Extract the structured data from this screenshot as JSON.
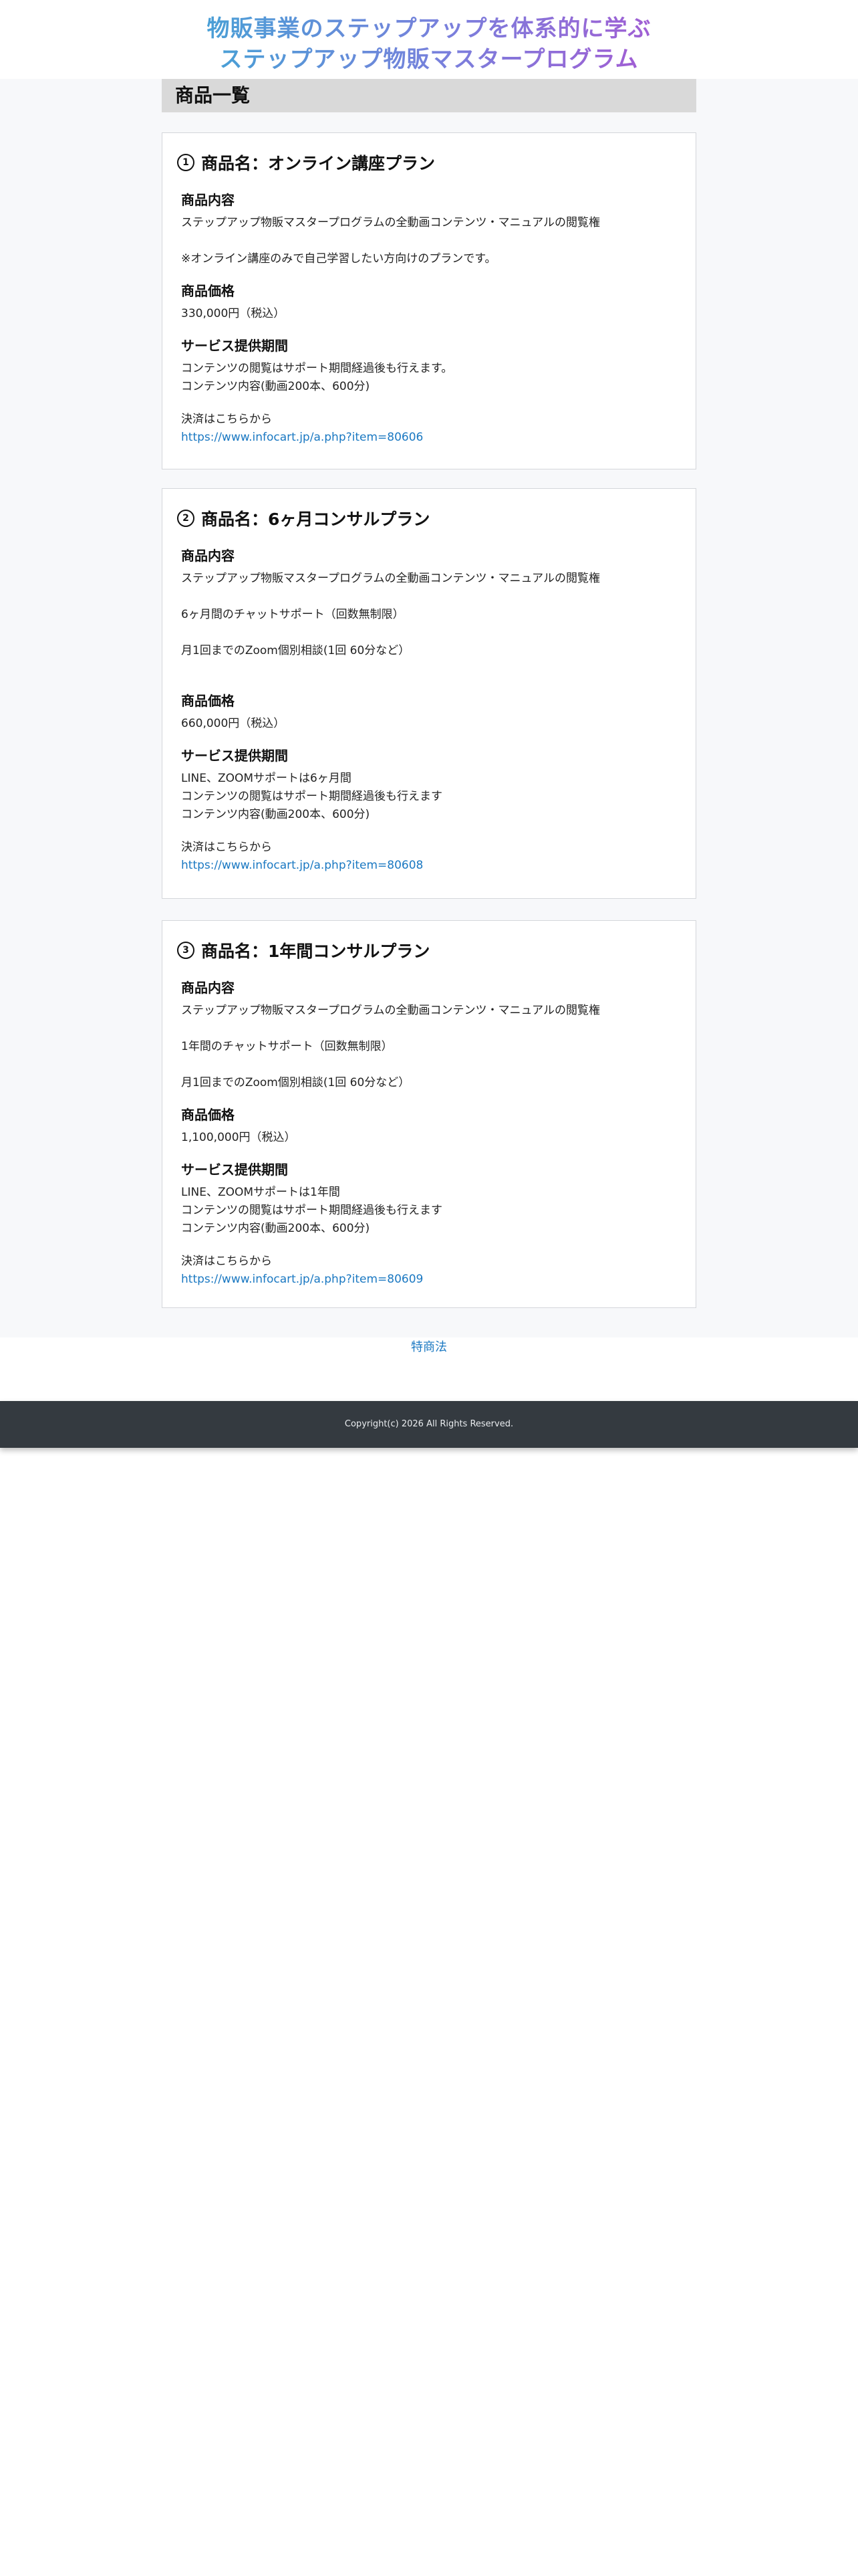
{
  "header": {
    "line1": "物販事業のステップアップを体系的に学ぶ",
    "line2": "ステップアップ物販マスタープログラム"
  },
  "section_title": "商品一覧",
  "plans": [
    {
      "number": "1",
      "title": "商品名：オンライン講座プラン",
      "content_heading": "商品内容",
      "content_lines": [
        "ステップアップ物販マスタープログラムの全動画コンテンツ・マニュアルの閲覧権",
        "",
        " ※オンライン講座のみで自己学習したい方向けのプランです。"
      ],
      "price_heading": "商品価格",
      "price": "330,000円（税込）",
      "period_heading": "サービス提供期間",
      "period_lines": [
        "コンテンツの閲覧はサポート期間経過後も行えます。",
        "コンテンツ内容(動画200本、600分)"
      ],
      "payment_label": "決済はこちらから",
      "payment_url": "https://www.infocart.jp/a.php?item=80606"
    },
    {
      "number": "2",
      "title": "商品名：6ヶ月コンサルプラン",
      "content_heading": "商品内容",
      "content_lines": [
        "ステップアップ物販マスタープログラムの全動画コンテンツ・マニュアルの閲覧権",
        "",
        "6ヶ月間のチャットサポート（回数無制限）",
        "",
        "月1回までのZoom個別相談(1回 60分など）",
        ""
      ],
      "price_heading": "商品価格",
      "price": "660,000円（税込）",
      "period_heading": "サービス提供期間",
      "period_lines": [
        "LINE、ZOOMサポートは6ヶ月間",
        "コンテンツの閲覧はサポート期間経過後も行えます",
        "コンテンツ内容(動画200本、600分)"
      ],
      "payment_label": "決済はこちらから",
      "payment_url": "https://www.infocart.jp/a.php?item=80608"
    },
    {
      "number": "3",
      "title": "商品名：1年間コンサルプラン",
      "content_heading": "商品内容",
      "content_lines": [
        "ステップアップ物販マスタープログラムの全動画コンテンツ・マニュアルの閲覧権",
        "",
        "1年間のチャットサポート（回数無制限）",
        "",
        "月1回までのZoom個別相談(1回 60分など）"
      ],
      "price_heading": "商品価格",
      "price": "1,100,000円（税込）",
      "period_heading": "サービス提供期間",
      "period_lines": [
        "LINE、ZOOMサポートは1年間",
        "コンテンツの閲覧はサポート期間経過後も行えます",
        "コンテンツ内容(動画200本、600分)"
      ],
      "payment_label": "決済はこちらから",
      "payment_url": "https://www.infocart.jp/a.php?item=80609"
    }
  ],
  "footer_link": "特商法",
  "copyright": "Copyright(c) 2026 All Rights Reserved."
}
